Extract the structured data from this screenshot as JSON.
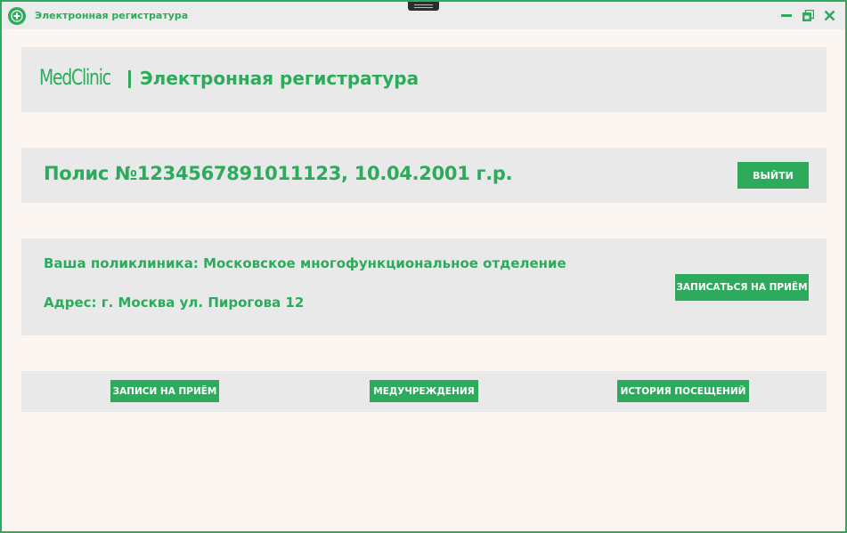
{
  "window": {
    "title": "Электронная регистратура",
    "accent_color": "#2eaa5c",
    "icons": [
      "app-logo-icon",
      "minimize-icon",
      "restore-icon",
      "close-icon"
    ]
  },
  "header": {
    "logo": "MedClinic",
    "subtitle": "Электронная регистратура"
  },
  "policy": {
    "text": "Полис №1234567891011123, 10.04.2001 г.р.",
    "logout_label": "ВЫЙТИ"
  },
  "clinic": {
    "name_line": "Ваша поликлиника: Московское многофункциональное отделение",
    "address_line": "Адрес: г. Москва ул. Пирогова 12",
    "appoint_label": "ЗАПИСАТЬСЯ НА ПРИЁМ"
  },
  "nav": {
    "records_label": "ЗАПИСИ НА ПРИЁМ",
    "institutions_label": "МЕДУЧРЕЖДЕНИЯ",
    "history_label": "ИСТОРИЯ ПОСЕЩЕНИЙ"
  }
}
